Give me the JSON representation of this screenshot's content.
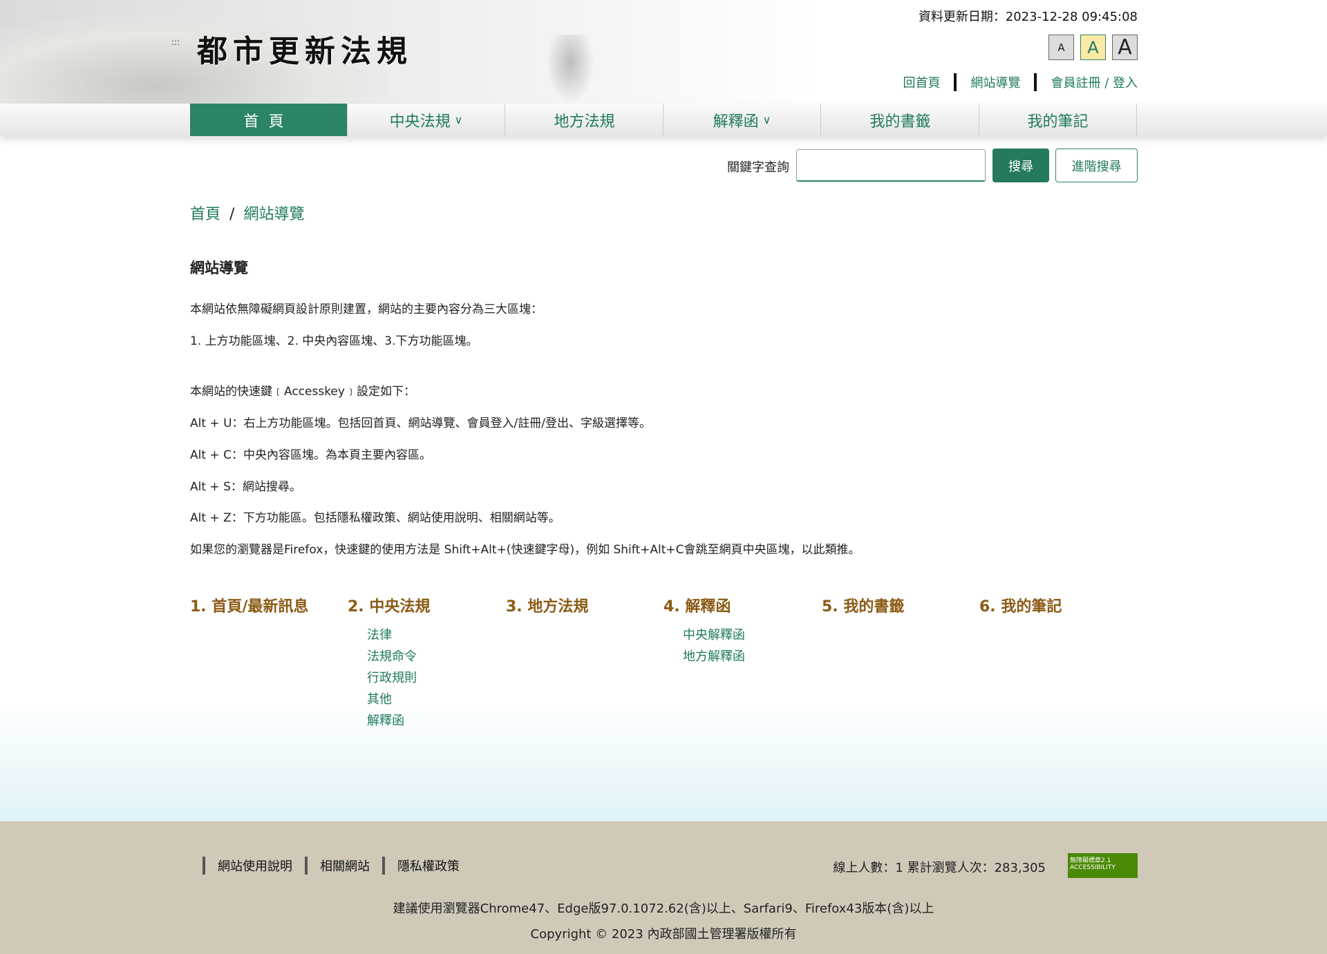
{
  "header": {
    "site_title": "都市更新法規",
    "accesskey_marker": ":::",
    "update_text": "資料更新日期：2023-12-28 09:45:08",
    "font_sizes": [
      {
        "label": "A",
        "name": "small"
      },
      {
        "label": "A",
        "name": "medium"
      },
      {
        "label": "A",
        "name": "large"
      }
    ],
    "links": [
      "回首頁",
      "網站導覽",
      "會員註冊 / 登入"
    ]
  },
  "nav": [
    {
      "label": "首頁"
    },
    {
      "label": "中央法規",
      "dropdown": true
    },
    {
      "label": "地方法規"
    },
    {
      "label": "解釋函",
      "dropdown": true
    },
    {
      "label": "我的書籤"
    },
    {
      "label": "我的筆記"
    }
  ],
  "search": {
    "label": "關鍵字查詢",
    "value": "",
    "search_button": "搜尋",
    "advanced_button": "進階搜尋"
  },
  "breadcrumb": {
    "home": "首頁",
    "sep": "/",
    "current": "網站導覽"
  },
  "main": {
    "title": "網站導覽",
    "paragraphs": [
      "本網站依無障礙網頁設計原則建置，網站的主要內容分為三大區塊：",
      "1. 上方功能區塊、2. 中央內容區塊、3.下方功能區塊。",
      "本網站的快速鍵﹝Accesskey﹞設定如下：",
      "Alt + U：右上方功能區塊。包括回首頁、網站導覽、會員登入/註冊/登出、字級選擇等。",
      "Alt + C：中央內容區塊。為本頁主要內容區。",
      "Alt + S：網站搜尋。",
      "Alt + Z：下方功能區。包括隱私權政策、網站使用說明、相關網站等。",
      "如果您的瀏覽器是Firefox，快速鍵的使用方法是 Shift+Alt+(快速鍵字母)，例如 Shift+Alt+C會跳至網頁中央區塊，以此類推。"
    ]
  },
  "sitemap": [
    {
      "title": "1. 首頁/最新訊息",
      "items": []
    },
    {
      "title": "2. 中央法規",
      "items": [
        "法律",
        "法規命令",
        "行政規則",
        "其他",
        "解釋函"
      ]
    },
    {
      "title": "3. 地方法規",
      "items": []
    },
    {
      "title": "4. 解釋函",
      "items": [
        "中央解釋函",
        "地方解釋函"
      ]
    },
    {
      "title": "5. 我的書籤",
      "items": []
    },
    {
      "title": "6. 我的筆記",
      "items": []
    }
  ],
  "footer": {
    "links": [
      "網站使用說明",
      "相關網站",
      "隱私權政策"
    ],
    "stats": "線上人數：1  累計瀏覽人次：283,305",
    "badge": "無障礙標章2.1 ACCESSIBILITY",
    "browser_note": "建議使用瀏覽器Chrome47、Edge版97.0.1072.62(含)以上、Sarfari9、Firefox43版本(含)以上",
    "copyright": "Copyright © 2023 內政部國土管理署版權所有"
  },
  "colors": {
    "primary": "#2b8468",
    "heading": "#8b5a14",
    "footer_bg": "#d0c9b8"
  }
}
